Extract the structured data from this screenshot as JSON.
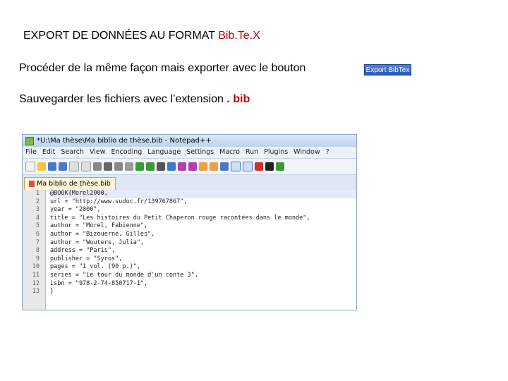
{
  "slide": {
    "title_main": "EXPORT DE DONNÉES AU FORMAT ",
    "title_accent": "Bib.Te.X",
    "line1": "Procéder de la même façon mais exporter avec le bouton",
    "line2_prefix": "Sauvegarder les fichiers  avec l’extension ",
    "line2_ext": ". bib",
    "export_button": "Export BibTex"
  },
  "notepad": {
    "window_title": "*U:\\Ma thèse\\Ma biblio de thèse.bib - Notepad++",
    "menu": [
      "File",
      "Edit",
      "Search",
      "View",
      "Encoding",
      "Language",
      "Settings",
      "Macro",
      "Run",
      "Plugins",
      "Window",
      "?"
    ],
    "tab_label": "Ma biblio de thèse.bib",
    "line_numbers": [
      "1",
      "2",
      "3",
      "4",
      "5",
      "6",
      "7",
      "8",
      "9",
      "10",
      "11",
      "12",
      "13"
    ],
    "code_lines": [
      "@BOOK{Morel2000,",
      "url = \"http://www.sudoc.fr/139767867\",",
      "year = \"2000\",",
      "title = \"Les histoires du Petit Chaperon rouge racontées dans le monde\",",
      "author = \"Morel, Fabienne\",",
      "author = \"Bizouerne, Gilles\",",
      "author = \"Wouters, Julia\",",
      "address = \"Paris\",",
      "publisher = \"Syros\",",
      "pages = \"1 vol. (90 p.)\",",
      "series = \"Le tour du monde d'un conte 3\",",
      "isbn = \"978-2-74-850717-1\",",
      "}"
    ],
    "colors": {
      "title_accent": "#c00000",
      "export_button": "#2f62c0"
    }
  }
}
